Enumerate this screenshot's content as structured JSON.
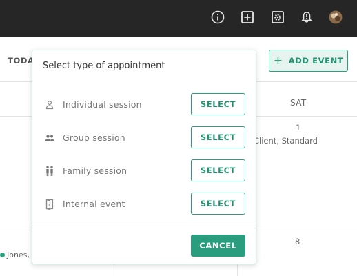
{
  "topbar": {
    "icons": [
      "info-icon",
      "add-box-icon",
      "settings-icon",
      "notification-bell-icon",
      "user-avatar"
    ]
  },
  "calendar": {
    "today_label": "TODA",
    "add_event_label": "ADD EVENT",
    "day_header": "SAT",
    "day_1": "1",
    "event_1": "Client, Standard",
    "day_8": "8",
    "event_2": "Jones,"
  },
  "popup": {
    "title": "Select type of appointment",
    "options": [
      {
        "label": "Individual session",
        "button": "SELECT",
        "icon": "person-icon"
      },
      {
        "label": "Group session",
        "button": "SELECT",
        "icon": "group-icon"
      },
      {
        "label": "Family session",
        "button": "SELECT",
        "icon": "family-icon"
      },
      {
        "label": "Internal event",
        "button": "SELECT",
        "icon": "door-icon"
      }
    ],
    "cancel_label": "CANCEL"
  },
  "colors": {
    "accent": "#2a9d7e",
    "topbar": "#262626"
  }
}
